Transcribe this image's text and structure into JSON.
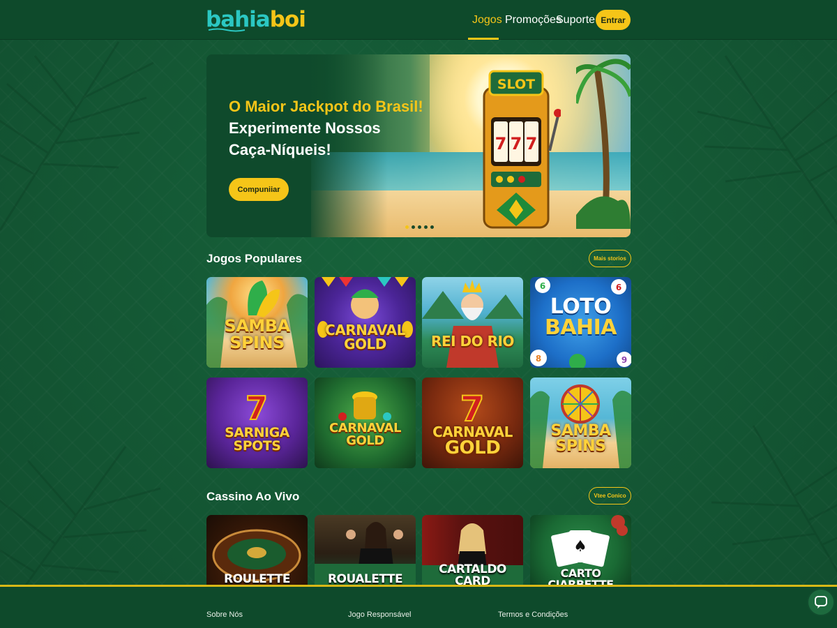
{
  "header": {
    "logo_part1": "bahia",
    "logo_part2": "boi",
    "nav": [
      {
        "label": "Jogos",
        "active": true
      },
      {
        "label": "Promoções",
        "active": false
      },
      {
        "label": "Suporte",
        "active": false
      }
    ],
    "login_label": "Entrar"
  },
  "hero": {
    "title_line1": "O Maior Jackpot do Brasil!",
    "title_line2": "Experimente Nossos",
    "title_line3": "Caça-Níqueis!",
    "cta_label": "Compuniiar",
    "slot_sign": "SLOT",
    "slot_reels": [
      "7",
      "7",
      "7"
    ],
    "carousel_count": 5,
    "carousel_active": 1
  },
  "popular": {
    "title": "Jogos Populares",
    "more_label": "Mais storios",
    "games": [
      {
        "line1": "SAMBA",
        "line2": "SPINS"
      },
      {
        "line1": "CARNAVAL",
        "line2": "GOLD"
      },
      {
        "line1": "REI DO",
        "line2": "RIO"
      },
      {
        "line1": "LOTO",
        "line2": "BAHIA"
      },
      {
        "line1": "SARNIGA",
        "line2": "SPOTS"
      },
      {
        "line1": "CARNAVAL",
        "line2": "GOLD"
      },
      {
        "line1": "CARNAVAL",
        "line2": "GOLD"
      },
      {
        "line1": "SAMBA",
        "line2": "SPINS"
      }
    ],
    "loto_balls": [
      "6",
      "6",
      "8",
      "9"
    ]
  },
  "live": {
    "title": "Cassino Ao Vivo",
    "more_label": "Vtee Conico",
    "games": [
      {
        "line1": "ROULETTE",
        "line2": ""
      },
      {
        "line1": "ROUALETTE",
        "line2": ""
      },
      {
        "line1": "CARTALDO",
        "line2": "CARD"
      },
      {
        "line1": "CARTO",
        "line2": "CIARBETTE"
      }
    ]
  },
  "footer": {
    "col1": "Sobre Nós",
    "col2": "Jogo Responsável",
    "col3": "Termos e Condições"
  },
  "colors": {
    "accent": "#f5c518",
    "background": "#155a36",
    "header": "#0e4a2b",
    "logo_teal": "#2bc7c2"
  },
  "icons": {
    "chat": "chat-bubble-icon"
  }
}
